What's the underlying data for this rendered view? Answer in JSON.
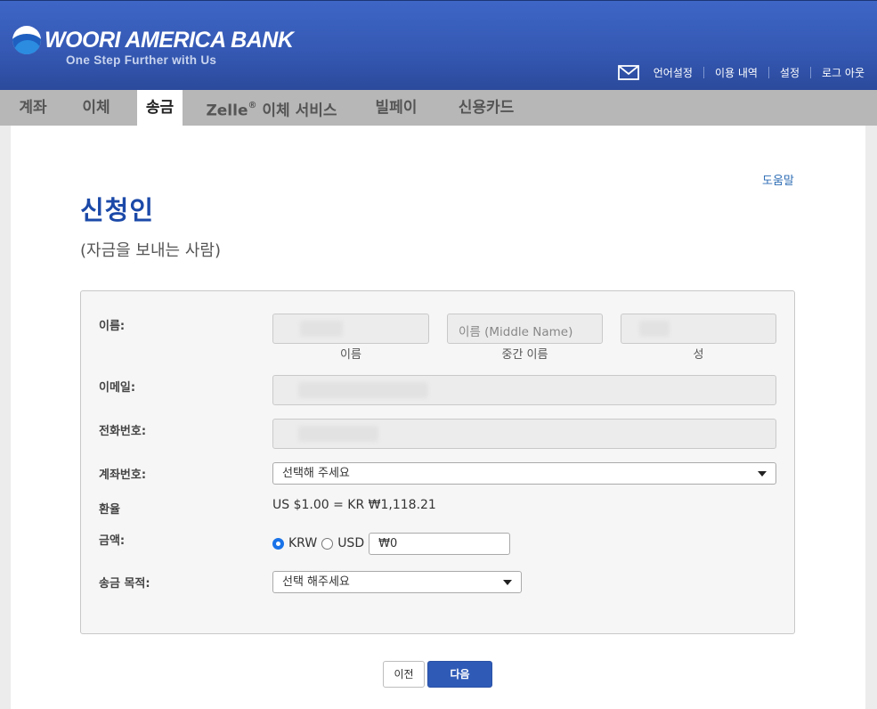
{
  "header": {
    "logo_text": "WOORI AMERICA BANK",
    "tagline": "One Step Further with Us",
    "util_links": [
      "언어설정",
      "이용 내역",
      "설정",
      "로그 아웃"
    ]
  },
  "nav": {
    "items": [
      "계좌",
      "이체",
      "송금",
      "Zelle",
      "이체 서비스",
      "빌페이",
      "신용카드"
    ],
    "zelle_mark": "®",
    "active": "송금"
  },
  "page": {
    "help": "도움말",
    "title": "신청인",
    "subtitle": "(자금을 보내는 사람)"
  },
  "form": {
    "name_label": "이름:",
    "first_caption": "이름",
    "middle_placeholder": "이름 (Middle Name)",
    "middle_caption": "중간 이름",
    "last_caption": "성",
    "email_label": "이메일:",
    "phone_label": "전화번호:",
    "account_label": "계좌번호:",
    "account_value": "선택해 주세요",
    "rate_label": "환율",
    "rate_value": "US $1.00 = KR ₩1,118.21",
    "amount_label": "금액:",
    "currency_options": [
      "KRW",
      "USD"
    ],
    "currency_selected": "KRW",
    "amount_value": "₩0",
    "purpose_label": "송금 목적:",
    "purpose_value": "선택 해주세요"
  },
  "buttons": {
    "prev": "이전",
    "next": "다음"
  },
  "colors": {
    "header_blue": "#3559b4",
    "title_blue": "#1b49a8",
    "next_button": "#2f5bb7"
  }
}
